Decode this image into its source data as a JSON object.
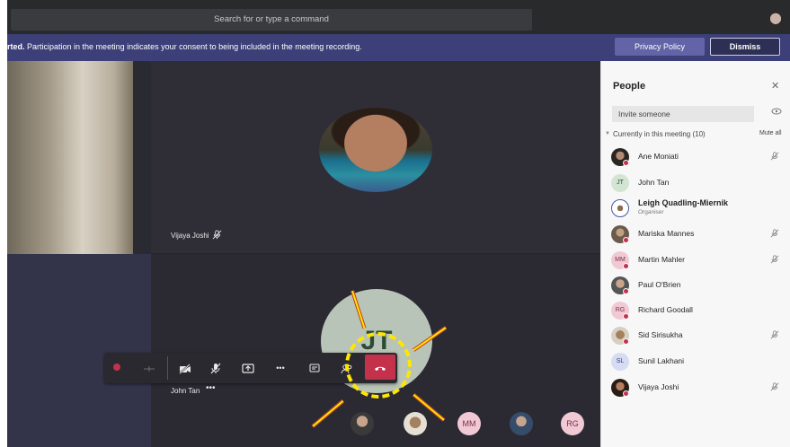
{
  "topbar": {
    "search_placeholder": "Search for or type a command"
  },
  "banner": {
    "bold_text": "rted.",
    "text": " Participation in the meeting indicates your consent to being included in the meeting recording.",
    "privacy_label": "Privacy Policy",
    "dismiss_label": "Dismiss"
  },
  "stage": {
    "vijaya_name": "Vijaya Joshi",
    "john_name": "John Tan",
    "john_initials": "JT",
    "john_more": "•••"
  },
  "controls": {
    "more_label": "•••"
  },
  "roster": {
    "mm_initials": "MM",
    "rg_initials": "RG"
  },
  "panel": {
    "title": "People",
    "invite_placeholder": "Invite someone",
    "section_label": "Currently in this meeting (10)",
    "mute_all": "Mute all",
    "people": [
      {
        "name": "Ane Moniati",
        "initials": "",
        "muted": true
      },
      {
        "name": "John Tan",
        "initials": "JT",
        "muted": false
      },
      {
        "name": "Leigh Quadling-Miernik",
        "initials": "",
        "sub": "Organiser",
        "muted": false
      },
      {
        "name": "Mariska Mannes",
        "initials": "",
        "muted": true
      },
      {
        "name": "Martin Mahler",
        "initials": "MM",
        "muted": true
      },
      {
        "name": "Paul O'Brien",
        "initials": "",
        "muted": false
      },
      {
        "name": "Richard Goodall",
        "initials": "RG",
        "muted": false
      },
      {
        "name": "Sid Sirisukha",
        "initials": "",
        "muted": true
      },
      {
        "name": "Sunil Lakhani",
        "initials": "SL",
        "muted": false
      },
      {
        "name": "Vijaya Joshi",
        "initials": "",
        "muted": true
      }
    ]
  },
  "colors": {
    "accent": "#6264a7",
    "hangup": "#c4314b",
    "annotation": "#ffe600"
  }
}
